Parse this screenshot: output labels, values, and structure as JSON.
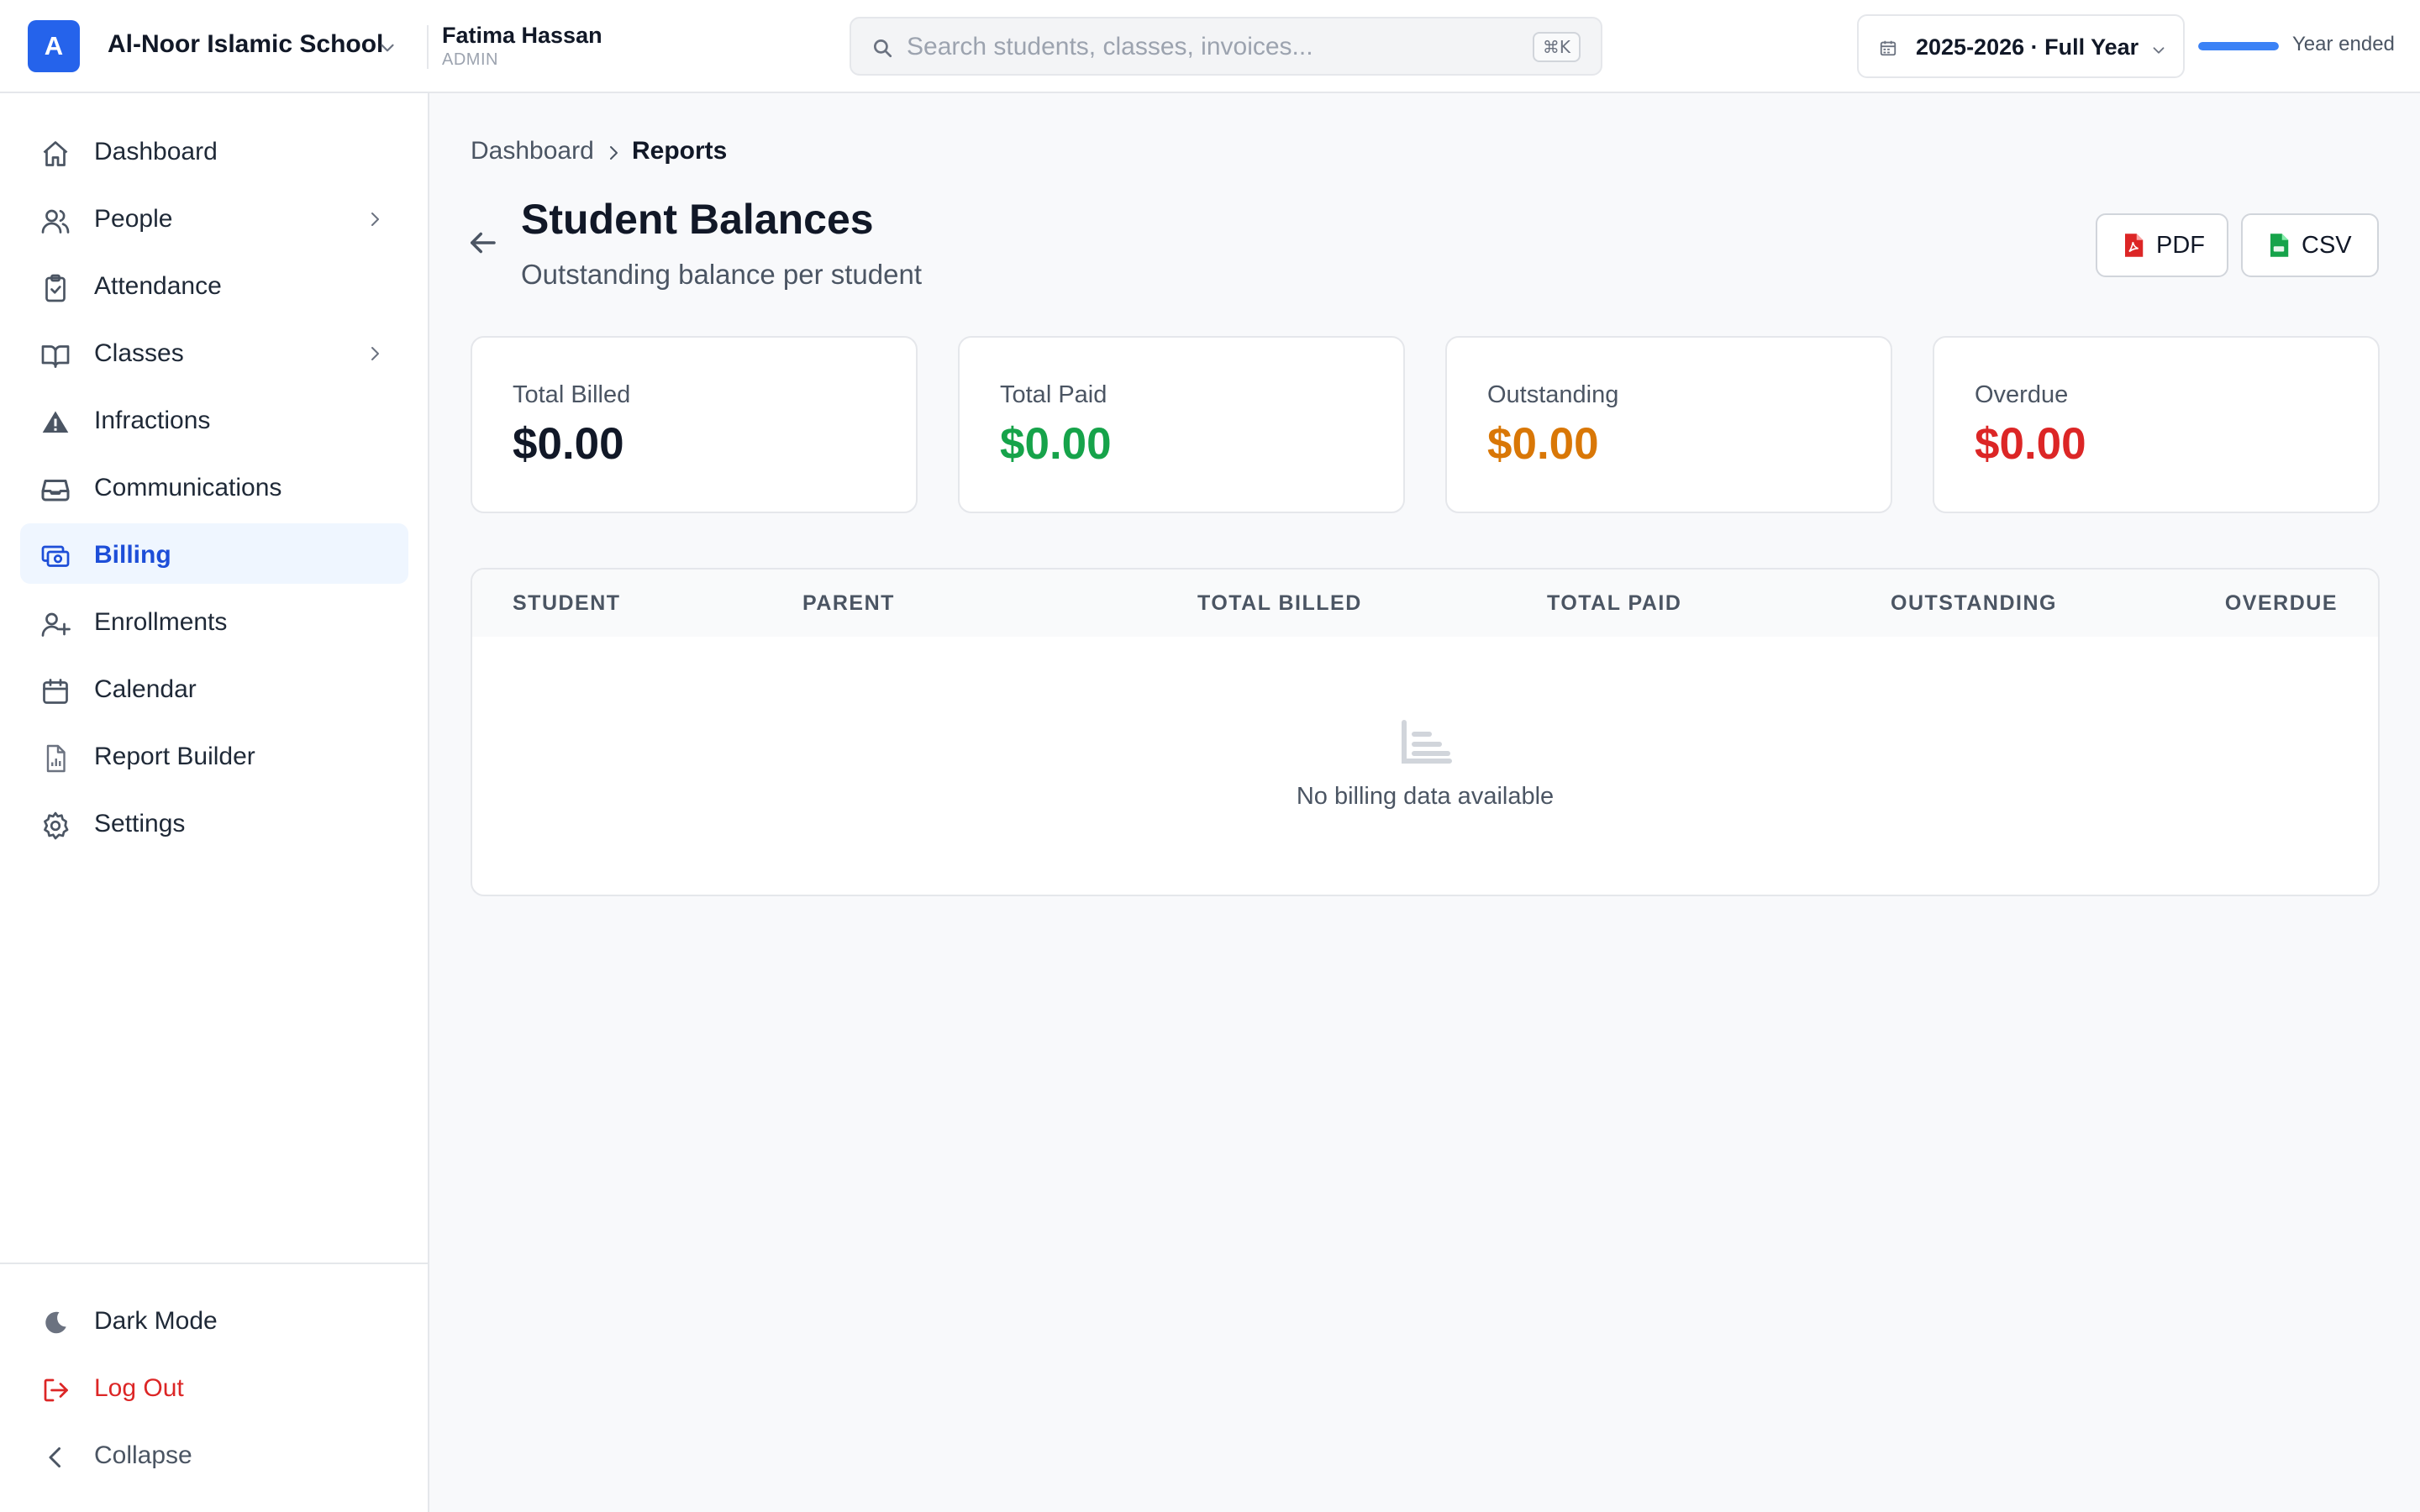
{
  "header": {
    "logo_letter": "A",
    "school_name": "Al-Noor Islamic School",
    "user_name": "Fatima Hassan",
    "user_role": "ADMIN",
    "search_placeholder": "Search students, classes, invoices...",
    "search_shortcut": "⌘K",
    "year_label": "2025-2026 · Full Year",
    "year_progress_percent": 100,
    "year_status": "Year ended"
  },
  "sidebar": {
    "items": [
      {
        "label": "Dashboard",
        "icon": "home-icon"
      },
      {
        "label": "People",
        "icon": "users-icon",
        "expandable": true
      },
      {
        "label": "Attendance",
        "icon": "clipboard-check-icon"
      },
      {
        "label": "Classes",
        "icon": "book-open-icon",
        "expandable": true
      },
      {
        "label": "Infractions",
        "icon": "warning-icon"
      },
      {
        "label": "Communications",
        "icon": "inbox-icon"
      },
      {
        "label": "Billing",
        "icon": "billing-icon",
        "active": true
      },
      {
        "label": "Enrollments",
        "icon": "user-plus-icon"
      },
      {
        "label": "Calendar",
        "icon": "calendar-icon"
      },
      {
        "label": "Report Builder",
        "icon": "report-icon"
      },
      {
        "label": "Settings",
        "icon": "gear-icon"
      }
    ],
    "bottom": {
      "dark_mode": "Dark Mode",
      "logout": "Log Out",
      "collapse": "Collapse"
    }
  },
  "breadcrumb": {
    "home": "Dashboard",
    "current": "Reports"
  },
  "page": {
    "title": "Student Balances",
    "subtitle": "Outstanding balance per student",
    "pdf_label": "PDF",
    "csv_label": "CSV"
  },
  "stats": [
    {
      "label": "Total Billed",
      "value": "$0.00",
      "color": "#111827"
    },
    {
      "label": "Total Paid",
      "value": "$0.00",
      "color": "#16a34a"
    },
    {
      "label": "Outstanding",
      "value": "$0.00",
      "color": "#d97706"
    },
    {
      "label": "Overdue",
      "value": "$0.00",
      "color": "#dc2626"
    }
  ],
  "table": {
    "columns": [
      "STUDENT",
      "PARENT",
      "TOTAL BILLED",
      "TOTAL PAID",
      "OUTSTANDING",
      "OVERDUE"
    ],
    "rows": [],
    "empty_text": "No billing data available"
  },
  "colors": {
    "accent": "#2563eb",
    "active_bg": "#eff6ff",
    "danger": "#dc2626"
  }
}
